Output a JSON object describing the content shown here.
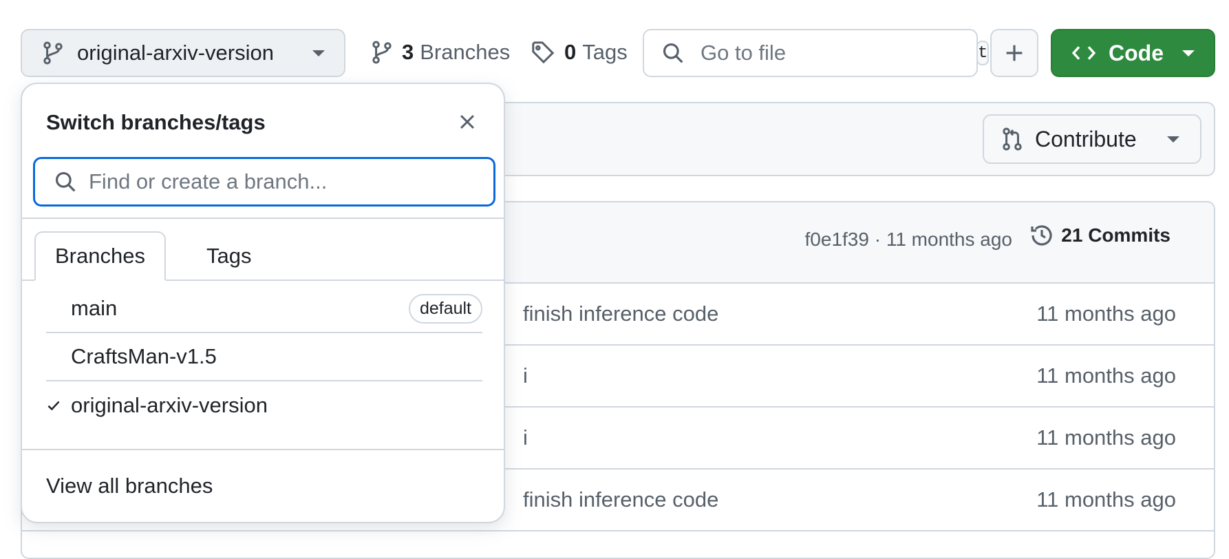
{
  "toolbar": {
    "branch_label": "original-arxiv-version",
    "branches_count": "3",
    "branches_label": "Branches",
    "tags_count": "0",
    "tags_label": "Tags",
    "go_to_file_placeholder": "Go to file",
    "go_to_file_shortcut": "t",
    "code_label": "Code"
  },
  "fork_bar": {
    "contribute_label": "Contribute"
  },
  "latest_commit": {
    "meta": "f0e1f39 · 11 months ago",
    "commits_label": "21 Commits"
  },
  "file_rows": [
    {
      "message": "finish inference code",
      "age": "11 months ago"
    },
    {
      "message": "i",
      "age": "11 months ago"
    },
    {
      "message": "i",
      "age": "11 months ago"
    },
    {
      "message": "finish inference code",
      "age": "11 months ago"
    }
  ],
  "branch_menu": {
    "title": "Switch branches/tags",
    "search_placeholder": "Find or create a branch...",
    "tabs": [
      {
        "label": "Branches",
        "active": true
      },
      {
        "label": "Tags",
        "active": false
      }
    ],
    "branches": [
      {
        "name": "main",
        "badge": "default",
        "selected": false
      },
      {
        "name": "CraftsMan-v1.5",
        "badge": "",
        "selected": false
      },
      {
        "name": "original-arxiv-version",
        "badge": "",
        "selected": true
      }
    ],
    "view_all_label": "View all branches"
  },
  "colors": {
    "accent_blue": "#0969da",
    "code_green": "#2d8a3e",
    "border": "#d0d7de",
    "muted_text": "#57606a"
  }
}
